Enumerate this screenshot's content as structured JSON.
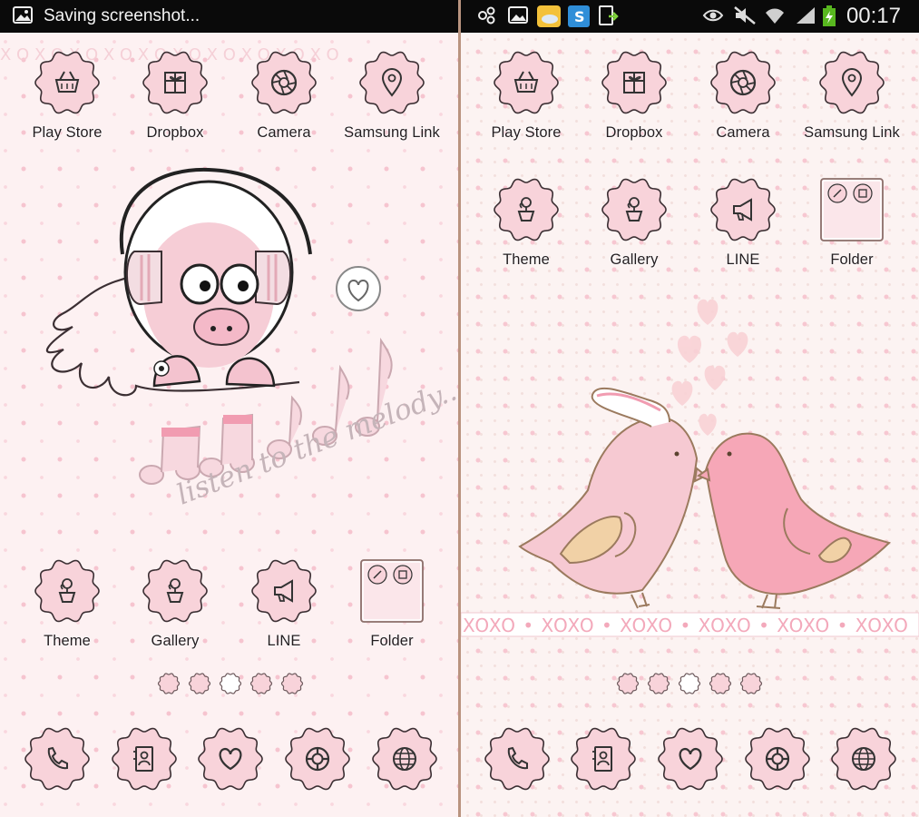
{
  "colors": {
    "flower_fill": "#f8d3da",
    "flower_stroke": "#3b2f33",
    "accent_pink": "#f19cb1",
    "status_bar": "#0a0a0a"
  },
  "left_screen": {
    "status_bar": {
      "notification_text": "Saving screenshot...",
      "icons": [
        "image-icon"
      ]
    },
    "top_row_apps": [
      {
        "label": "Play Store",
        "icon": "basket-icon"
      },
      {
        "label": "Dropbox",
        "icon": "gift-box-icon"
      },
      {
        "label": "Camera",
        "icon": "camera-shutter-icon"
      },
      {
        "label": "Samsung Link",
        "icon": "location-pin-icon"
      }
    ],
    "widget": {
      "caption": "listen to the melody..."
    },
    "bottom_row_apps": [
      {
        "label": "Theme",
        "icon": "flower-pot-icon"
      },
      {
        "label": "Gallery",
        "icon": "flower-pot-icon"
      },
      {
        "label": "LINE",
        "icon": "megaphone-icon"
      },
      {
        "label": "Folder",
        "icon": "folder-icon"
      }
    ],
    "page_indicator": {
      "count": 5,
      "current": 3
    },
    "dock": [
      {
        "name": "phone",
        "icon": "phone-icon"
      },
      {
        "name": "contacts",
        "icon": "contacts-icon"
      },
      {
        "name": "favorites",
        "icon": "heart-icon"
      },
      {
        "name": "internet",
        "icon": "life-ring-icon"
      },
      {
        "name": "browser",
        "icon": "globe-icon"
      }
    ]
  },
  "right_screen": {
    "status_bar": {
      "clock": "00:17",
      "battery_state": "charging",
      "icons": [
        "network-icon",
        "image-icon",
        "weather-icon",
        "s-note-icon",
        "download-icon",
        "eye-icon",
        "mute-icon",
        "wifi-icon",
        "signal-icon",
        "battery-icon"
      ]
    },
    "top_row_apps": [
      {
        "label": "Play Store",
        "icon": "basket-icon"
      },
      {
        "label": "Dropbox",
        "icon": "gift-box-icon"
      },
      {
        "label": "Camera",
        "icon": "camera-shutter-icon"
      },
      {
        "label": "Samsung Link",
        "icon": "location-pin-icon"
      }
    ],
    "second_row_apps": [
      {
        "label": "Theme",
        "icon": "flower-pot-icon"
      },
      {
        "label": "Gallery",
        "icon": "flower-pot-icon"
      },
      {
        "label": "LINE",
        "icon": "megaphone-icon"
      },
      {
        "label": "Folder",
        "icon": "folder-icon"
      }
    ],
    "page_indicator": {
      "count": 5,
      "current": 3
    },
    "dock": [
      {
        "name": "phone",
        "icon": "phone-icon"
      },
      {
        "name": "contacts",
        "icon": "contacts-icon"
      },
      {
        "name": "favorites",
        "icon": "heart-icon"
      },
      {
        "name": "internet",
        "icon": "life-ring-icon"
      },
      {
        "name": "browser",
        "icon": "globe-icon"
      }
    ]
  }
}
